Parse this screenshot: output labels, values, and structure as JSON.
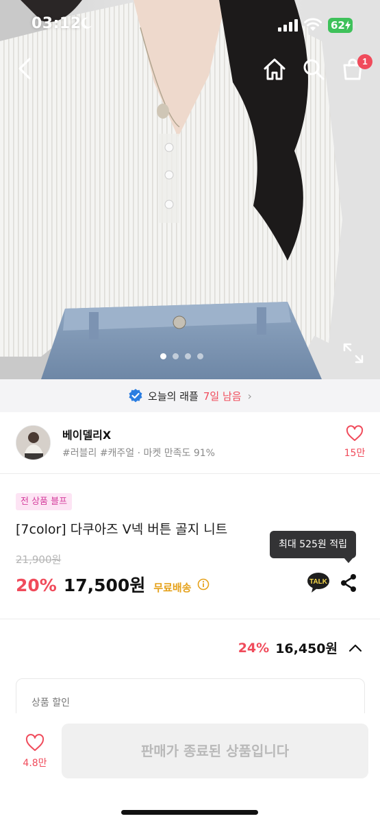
{
  "status_bar": {
    "time": "03:12",
    "battery": "62"
  },
  "top_nav": {
    "cart_badge": "1"
  },
  "gallery": {
    "page_count": 4,
    "active_index": 0
  },
  "raffle": {
    "text": "오늘의 래플",
    "remaining": "7일 남음",
    "chevron": "›"
  },
  "seller": {
    "name": "베이델리X",
    "tags": "#러블리 #캐주얼 · 마켓 만족도 91%",
    "likes": "15만"
  },
  "product": {
    "badge": "전 상품 블프",
    "title": "[7color] 다쿠아즈 V넥 버튼 골지 니트",
    "original_price": "21,900원",
    "discount_rate": "20%",
    "price": "17,500원",
    "shipping": "무료배송",
    "points_tooltip": "최대 525원 적립"
  },
  "best_price": {
    "discount_rate": "24%",
    "price": "16,450원"
  },
  "discount_section": {
    "label": "상품 할인"
  },
  "bottom_bar": {
    "likes": "4.8만",
    "sold_out_label": "판매가 종료된 상품입니다"
  },
  "colors": {
    "accent_red": "#f04b5b",
    "badge_pink_bg": "#fde4f4",
    "badge_pink_text": "#d43c9b",
    "free_shipping": "#e5a11a",
    "tooltip_bg": "#333335",
    "battery_green": "#3ec15a",
    "verified_blue": "#2a7de1"
  },
  "icons": [
    "back-icon",
    "home-icon",
    "search-icon",
    "shopping-bag-icon",
    "expand-icon",
    "verified-icon",
    "heart-icon",
    "info-icon",
    "kakao-talk-icon",
    "share-icon",
    "chevron-up-icon"
  ]
}
